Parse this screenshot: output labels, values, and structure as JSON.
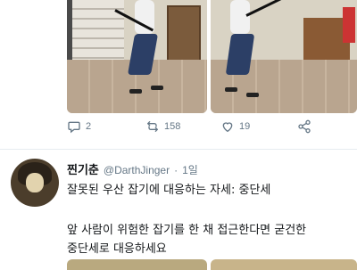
{
  "previous_tweet": {
    "images": [
      {
        "alt": "man-with-umbrella-left-photo"
      },
      {
        "alt": "man-with-umbrella-right-photo"
      }
    ],
    "actions": {
      "reply_count": "2",
      "retweet_count": "158",
      "like_count": "19"
    }
  },
  "tweet": {
    "display_name": "찐기춘",
    "handle": "@DarthJinger",
    "separator": "·",
    "time": "1일",
    "line1": "잘못된 우산 잡기에 대응하는 자세: 중단세",
    "line2": "앞 사람이 위험한 잡기를 한 채 접근한다면 굳건한",
    "line3": "중단세로 대응하세요"
  },
  "colors": {
    "text": "#14171a",
    "muted": "#657786",
    "divider": "#e6ecf0"
  }
}
